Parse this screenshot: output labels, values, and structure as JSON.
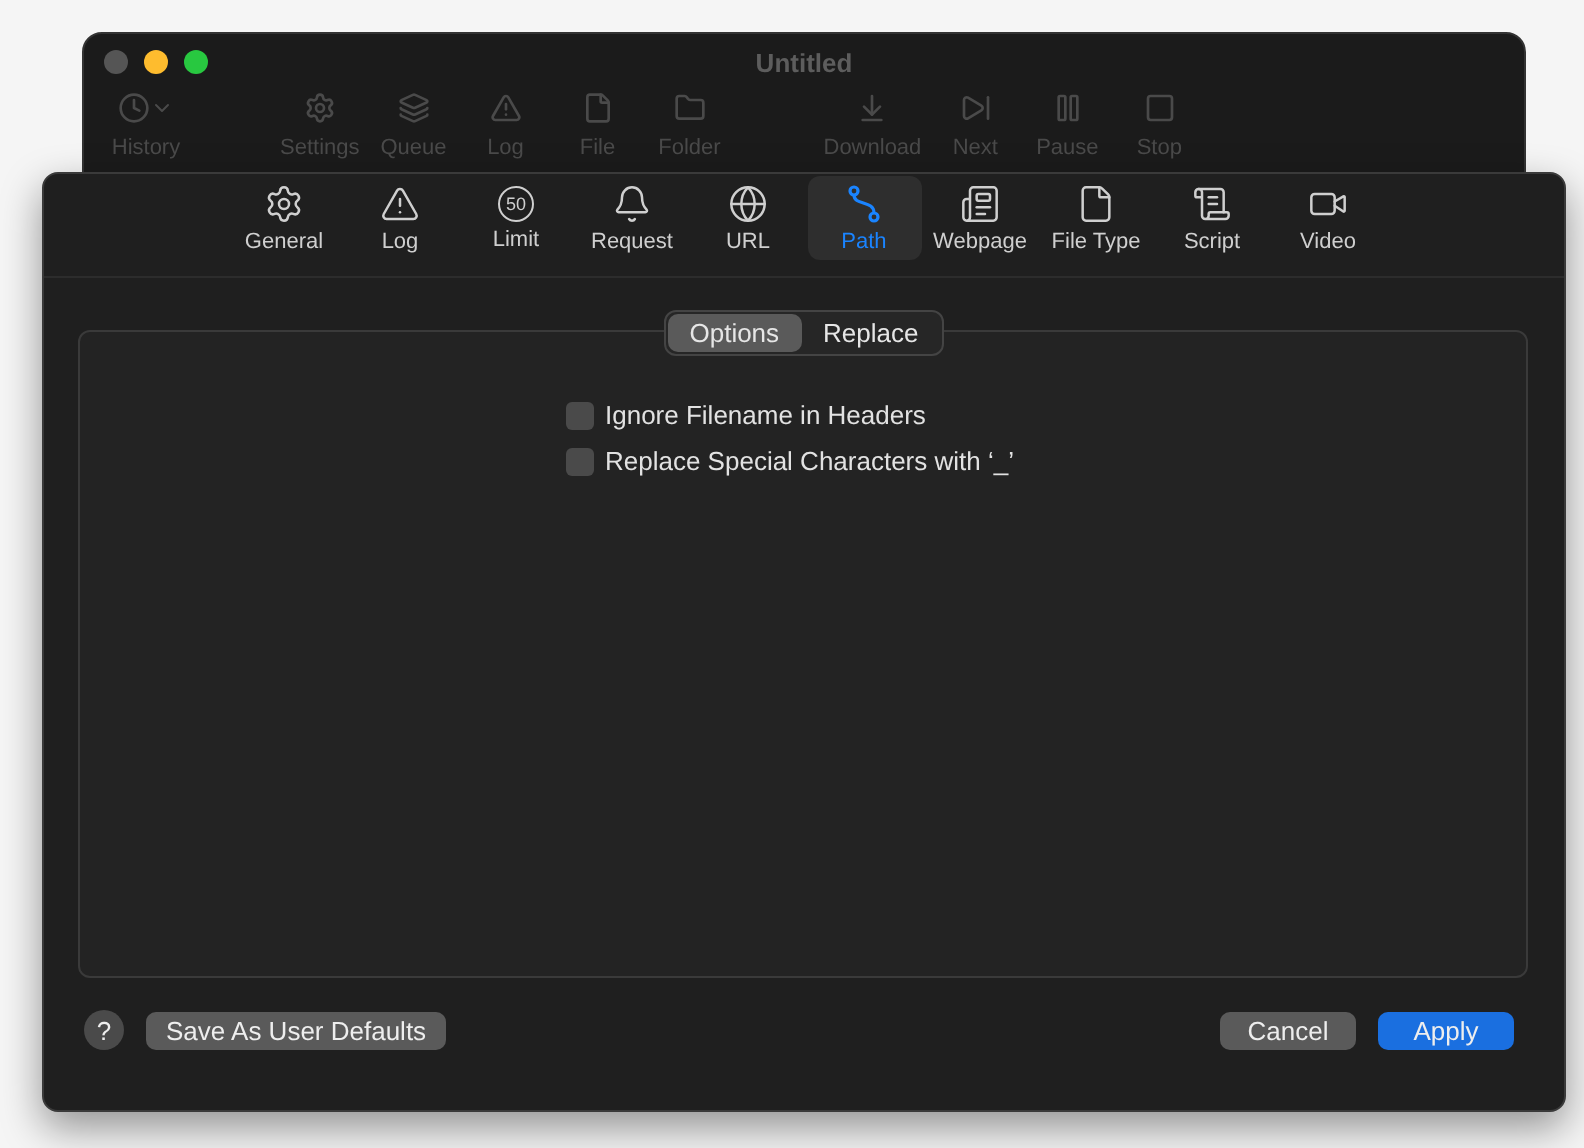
{
  "back_window": {
    "title": "Untitled",
    "toolbar_groups": [
      {
        "items": [
          {
            "kind": "history",
            "label": "History"
          }
        ]
      },
      {
        "items": [
          {
            "kind": "settings",
            "label": "Settings"
          },
          {
            "kind": "queue",
            "label": "Queue"
          },
          {
            "kind": "log",
            "label": "Log"
          },
          {
            "kind": "file",
            "label": "File"
          },
          {
            "kind": "folder",
            "label": "Folder"
          }
        ]
      },
      {
        "items": [
          {
            "kind": "download",
            "label": "Download"
          },
          {
            "kind": "next",
            "label": "Next"
          },
          {
            "kind": "pause",
            "label": "Pause"
          },
          {
            "kind": "stop",
            "label": "Stop"
          }
        ]
      }
    ]
  },
  "sheet": {
    "tabs": [
      {
        "kind": "general",
        "label": "General",
        "selected": false
      },
      {
        "kind": "log",
        "label": "Log",
        "selected": false
      },
      {
        "kind": "limit",
        "label": "Limit",
        "icon_text": "50",
        "selected": false
      },
      {
        "kind": "request",
        "label": "Request",
        "selected": false
      },
      {
        "kind": "url",
        "label": "URL",
        "selected": false
      },
      {
        "kind": "path",
        "label": "Path",
        "selected": true
      },
      {
        "kind": "webpage",
        "label": "Webpage",
        "selected": false
      },
      {
        "kind": "filetype",
        "label": "File Type",
        "selected": false
      },
      {
        "kind": "script",
        "label": "Script",
        "selected": false
      },
      {
        "kind": "video",
        "label": "Video",
        "selected": false
      }
    ],
    "segments": [
      {
        "label": "Options",
        "selected": true
      },
      {
        "label": "Replace",
        "selected": false
      }
    ],
    "options": [
      {
        "label": "Ignore Filename in Headers",
        "checked": false
      },
      {
        "label": "Replace Special Characters with ‘_’",
        "checked": false
      }
    ],
    "help": "?",
    "save_defaults": "Save As User Defaults",
    "cancel": "Cancel",
    "apply": "Apply"
  }
}
